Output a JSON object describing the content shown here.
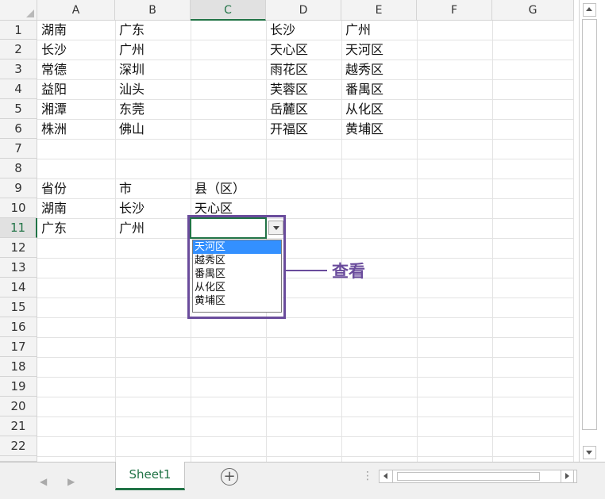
{
  "columns": [
    "A",
    "B",
    "C",
    "D",
    "E",
    "F",
    "G"
  ],
  "selected_column": "C",
  "rows": [
    "1",
    "2",
    "3",
    "4",
    "5",
    "6",
    "7",
    "8",
    "9",
    "10",
    "11",
    "12",
    "13",
    "14",
    "15",
    "16",
    "17",
    "18",
    "19",
    "20",
    "21",
    "22"
  ],
  "selected_row": "11",
  "cells": {
    "A1": "湖南",
    "B1": "广东",
    "D1": "长沙",
    "E1": "广州",
    "A2": "长沙",
    "B2": "广州",
    "D2": "天心区",
    "E2": "天河区",
    "A3": "常德",
    "B3": "深圳",
    "D3": "雨花区",
    "E3": "越秀区",
    "A4": "益阳",
    "B4": "汕头",
    "D4": "芙蓉区",
    "E4": "番禺区",
    "A5": "湘潭",
    "B5": "东莞",
    "D5": "岳麓区",
    "E5": "从化区",
    "A6": "株洲",
    "B6": "佛山",
    "D6": "开福区",
    "E6": "黄埔区",
    "A9": "省份",
    "B9": "市",
    "C9": "县（区）",
    "A10": "湖南",
    "B10": "长沙",
    "C10": "天心区",
    "A11": "广东",
    "B11": "广州",
    "C11": ""
  },
  "dropdown": {
    "options": [
      "天河区",
      "越秀区",
      "番禺区",
      "从化区",
      "黄埔区"
    ],
    "selected": "天河区"
  },
  "annotation": {
    "label": "查看",
    "color": "#6a4c9c"
  },
  "sheet_tabs": [
    {
      "label": "Sheet1",
      "active": true
    }
  ],
  "add_sheet_icon": "plus-circle-icon",
  "accent_color": "#217346"
}
